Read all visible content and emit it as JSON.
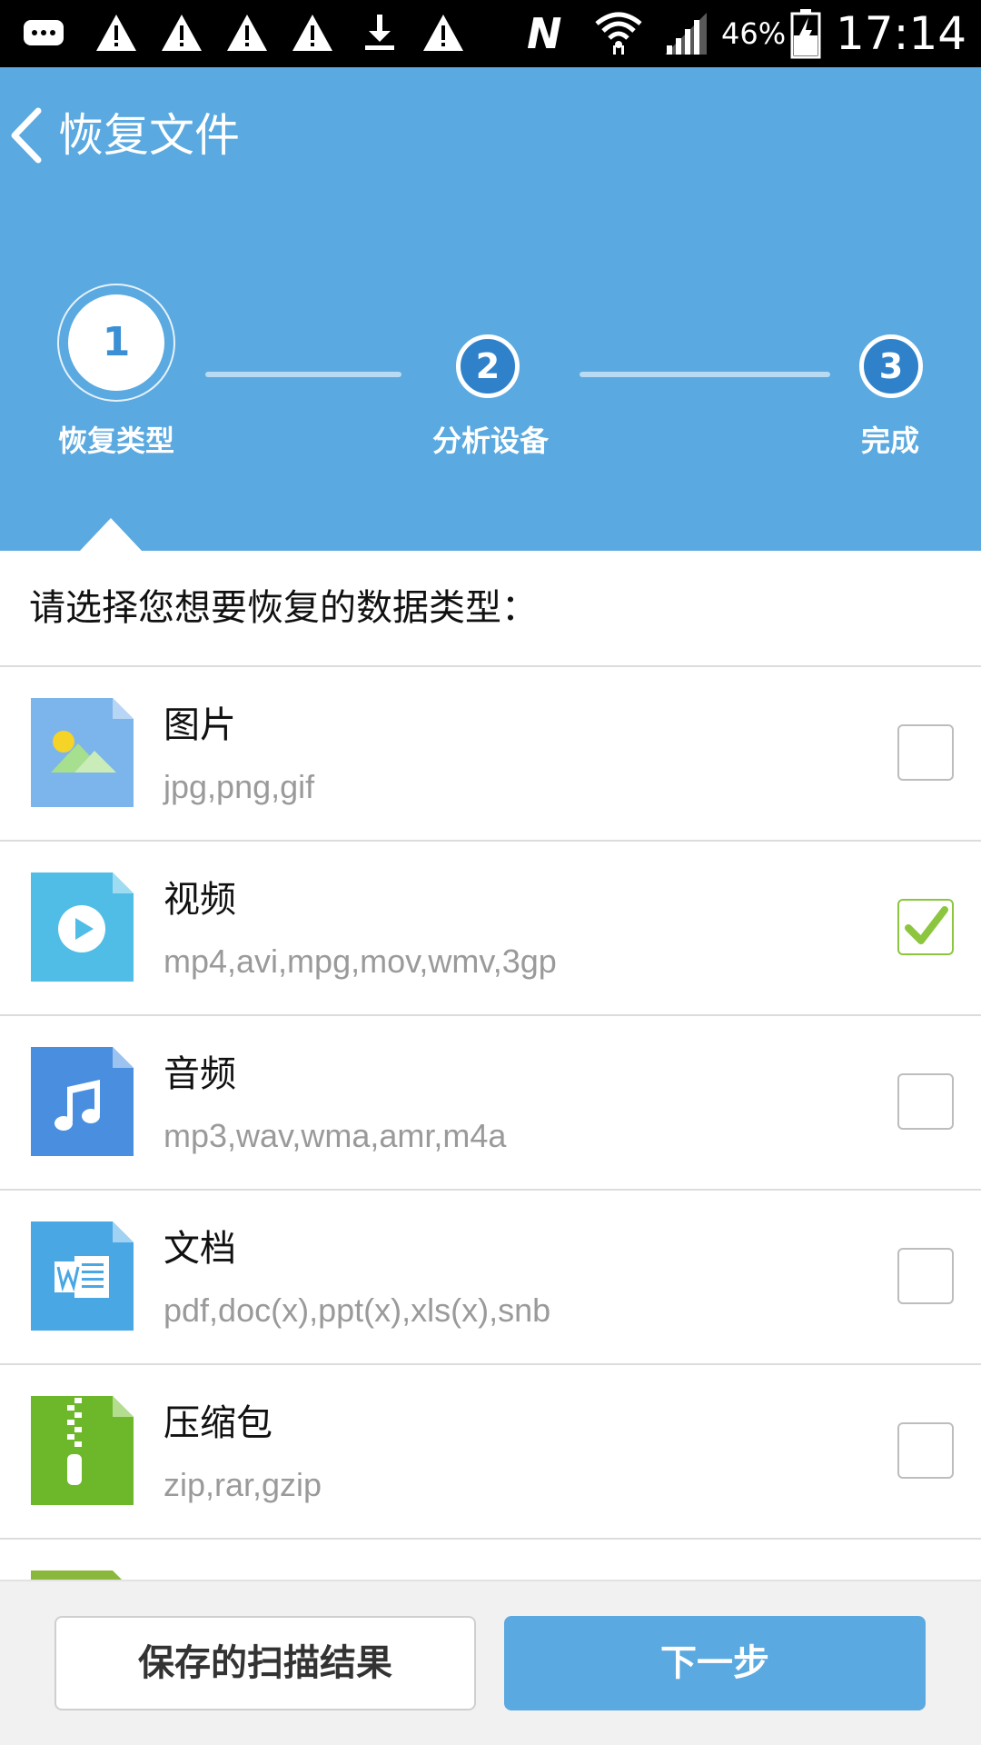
{
  "status_bar": {
    "left_icons": [
      "message-icon",
      "warning-icon",
      "warning-icon",
      "warning-icon",
      "warning-icon",
      "download-icon",
      "warning-icon"
    ],
    "right_icons": [
      "nfc-icon",
      "wifi-icon",
      "signal-icon",
      "battery-icon"
    ],
    "battery": "46%",
    "time": "17:14"
  },
  "header": {
    "title": "恢复文件",
    "background": "#5aa9e0"
  },
  "stepper": {
    "active_step": 1,
    "steps": [
      {
        "number": "1",
        "label": "恢复类型"
      },
      {
        "number": "2",
        "label": "分析设备"
      },
      {
        "number": "3",
        "label": "完成"
      }
    ]
  },
  "prompt": "请选择您想要恢复的数据类型：",
  "types": [
    {
      "name": "图片",
      "extensions": "jpg,png,gif",
      "icon": "image-file-icon",
      "checked": false
    },
    {
      "name": "视频",
      "extensions": "mp4,avi,mpg,mov,wmv,3gp",
      "icon": "video-file-icon",
      "checked": true
    },
    {
      "name": "音频",
      "extensions": "mp3,wav,wma,amr,m4a",
      "icon": "audio-file-icon",
      "checked": false
    },
    {
      "name": "文档",
      "extensions": "pdf,doc(x),ppt(x),xls(x),snb",
      "icon": "document-file-icon",
      "checked": false
    },
    {
      "name": "压缩包",
      "extensions": "zip,rar,gzip",
      "icon": "archive-file-icon",
      "checked": false
    }
  ],
  "footer": {
    "saved_results_label": "保存的扫描结果",
    "next_label": "下一步"
  },
  "colors": {
    "accent": "#5aa9e0",
    "step_pending": "#2f82ca",
    "check": "#8cc63f",
    "image_icon": "#7cb4ec",
    "video_icon": "#4fbde6",
    "audio_icon": "#4a8fdf",
    "document_icon": "#49a7e4",
    "archive_icon": "#6db82a"
  }
}
